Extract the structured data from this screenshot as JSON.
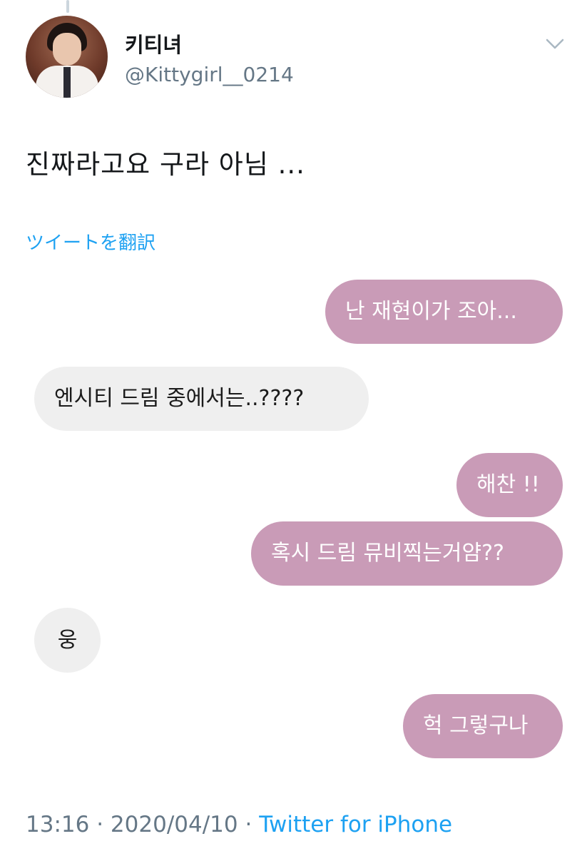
{
  "tweet": {
    "display_name": "키티녀",
    "handle": "@Kittygirl__0214",
    "text": "진짜라고요 구라 아님 ...",
    "translate_label": "ツイートを翻訳",
    "icons": {
      "more": "chevron-down-icon",
      "avatar": "avatar"
    }
  },
  "chat": {
    "colors": {
      "me": "#c99bb7",
      "them": "#efefef"
    },
    "messages": [
      {
        "side": "me",
        "text": "난 재현이가 조아..."
      },
      {
        "side": "them",
        "text": "엔시티 드림 중에서는..????"
      },
      {
        "side": "me",
        "text": "해찬 !!"
      },
      {
        "side": "me",
        "text": "혹시 드림 뮤비찍는거얌??"
      },
      {
        "side": "them",
        "text": "웅"
      },
      {
        "side": "me",
        "text": "헉 그렇구나"
      }
    ]
  },
  "footer": {
    "time": "13:16",
    "separator": "·",
    "date": "2020/04/10",
    "source": "Twitter for iPhone"
  }
}
